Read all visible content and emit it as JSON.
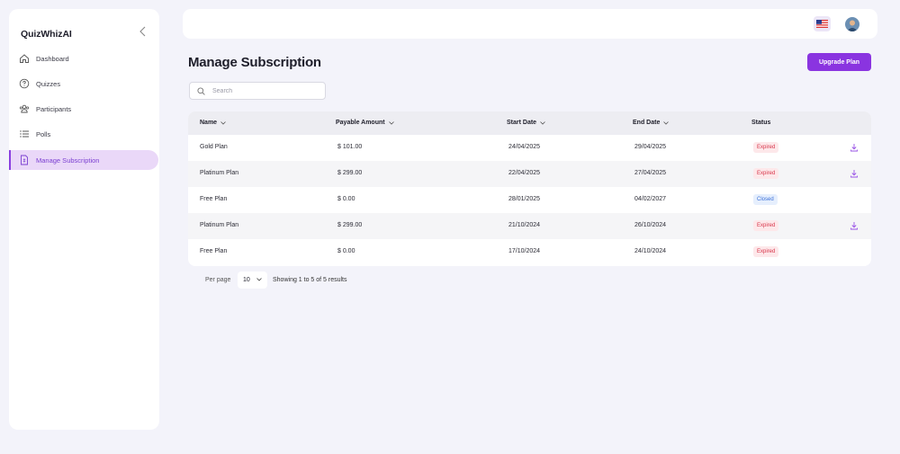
{
  "app": {
    "brand": "QuizWhizAI"
  },
  "sidebar": {
    "items": [
      {
        "label": "Dashboard",
        "icon": "home-icon"
      },
      {
        "label": "Quizzes",
        "icon": "question-circle-icon"
      },
      {
        "label": "Participants",
        "icon": "users-icon"
      },
      {
        "label": "Polls",
        "icon": "list-icon"
      },
      {
        "label": "Manage Subscription",
        "icon": "subscription-doc-icon",
        "active": true
      }
    ]
  },
  "page": {
    "title": "Manage Subscription",
    "upgrade_label": "Upgrade Plan"
  },
  "search": {
    "placeholder": "Search",
    "value": ""
  },
  "table": {
    "columns": [
      "Name",
      "Payable Amount",
      "Start Date",
      "End Date",
      "Status"
    ],
    "rows": [
      {
        "name": "Gold Plan",
        "amount": "$ 101.00",
        "start": "24/04/2025",
        "end": "29/04/2025",
        "status": "Expired",
        "download": true
      },
      {
        "name": "Platinum Plan",
        "amount": "$ 299.00",
        "start": "22/04/2025",
        "end": "27/04/2025",
        "status": "Expired",
        "download": true
      },
      {
        "name": "Free Plan",
        "amount": "$ 0.00",
        "start": "28/01/2025",
        "end": "04/02/2027",
        "status": "Closed",
        "download": false
      },
      {
        "name": "Platinum Plan",
        "amount": "$ 299.00",
        "start": "21/10/2024",
        "end": "26/10/2024",
        "status": "Expired",
        "download": true
      },
      {
        "name": "Free Plan",
        "amount": "$ 0.00",
        "start": "17/10/2024",
        "end": "24/10/2024",
        "status": "Expired",
        "download": false
      }
    ]
  },
  "pagination": {
    "per_page_label": "Per page",
    "per_page_value": "10",
    "info": "Showing 1 to 5 of 5 results"
  },
  "colors": {
    "accent": "#8a34e0",
    "expired": "#d8354a",
    "closed": "#3a6fd8",
    "background": "#f3f3fa"
  }
}
